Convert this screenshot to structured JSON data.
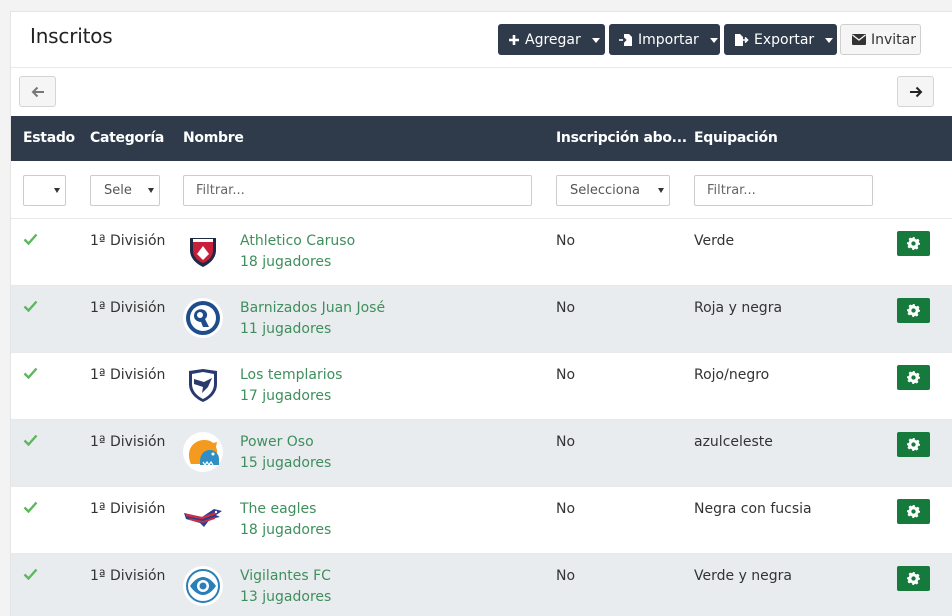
{
  "header": {
    "title": "Inscritos",
    "add_label": "Agregar",
    "import_label": "Importar",
    "export_label": "Exportar",
    "invite_label": "Invitar"
  },
  "table": {
    "columns": [
      "Estado",
      "Categoría",
      "Nombre",
      "Inscripción abo...",
      "Equipación"
    ],
    "filters": {
      "estado_value": "",
      "categoria_value": "Sele",
      "nombre_placeholder": "Filtrar...",
      "inscripcion_value": "Selecciona",
      "equipacion_placeholder": "Filtrar..."
    },
    "rows": [
      {
        "status": "check-icon",
        "category": "1ª División",
        "logo": "team-logo-shield-red",
        "name": "Athletico Caruso",
        "players": "18 jugadores",
        "abono": "No",
        "kit": "Verde"
      },
      {
        "status": "check-icon",
        "category": "1ª División",
        "logo": "team-logo-ram",
        "name": "Barnizados Juan José",
        "players": "11 jugadores",
        "abono": "No",
        "kit": "Roja y negra"
      },
      {
        "status": "check-icon",
        "category": "1ª División",
        "logo": "team-logo-shield-eagle",
        "name": "Los templarios",
        "players": "17 jugadores",
        "abono": "No",
        "kit": "Rojo/negro"
      },
      {
        "status": "check-icon",
        "category": "1ª División",
        "logo": "team-logo-bear",
        "name": "Power Oso",
        "players": "15 jugadores",
        "abono": "No",
        "kit": "azulceleste"
      },
      {
        "status": "check-icon",
        "category": "1ª División",
        "logo": "team-logo-eagle-flying",
        "name": "The eagles",
        "players": "18 jugadores",
        "abono": "No",
        "kit": "Negra con fucsia"
      },
      {
        "status": "check-icon",
        "category": "1ª División",
        "logo": "team-logo-eye",
        "name": "Vigilantes FC",
        "players": "13 jugadores",
        "abono": "No",
        "kit": "Verde y negra"
      }
    ]
  },
  "colors": {
    "header_bg": "#2f3b4b",
    "link_green": "#3e8f5c",
    "action_green": "#157a3c",
    "row_alt_bg": "#e9ecef"
  }
}
